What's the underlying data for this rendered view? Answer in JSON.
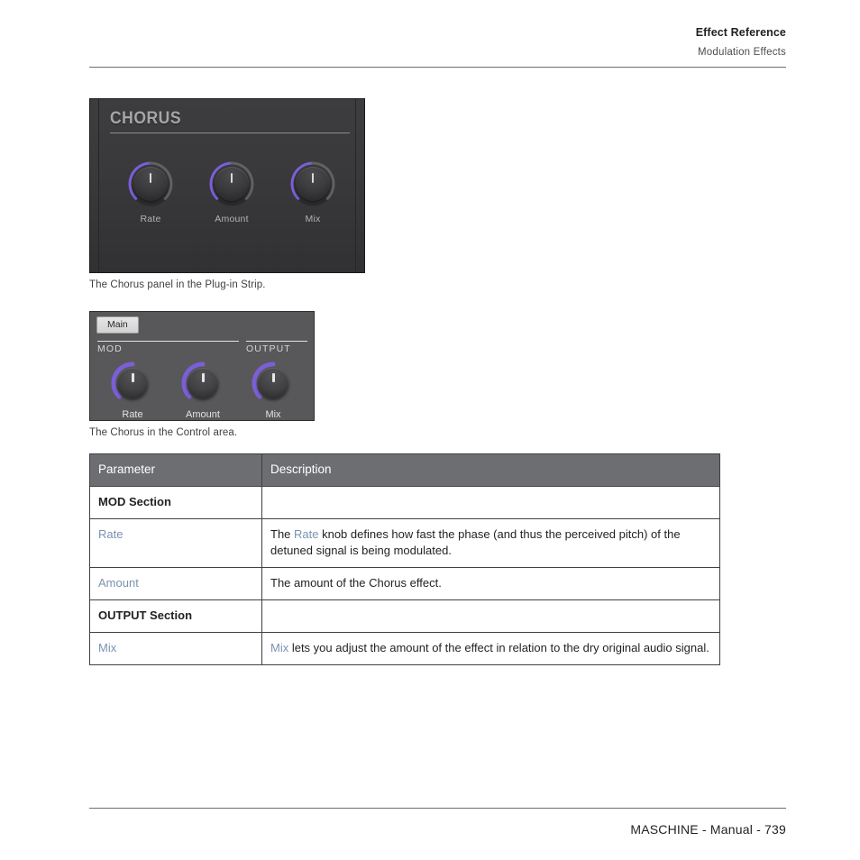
{
  "header": {
    "title": "Effect Reference",
    "subtitle": "Modulation Effects"
  },
  "plugin_strip": {
    "panel_title": "CHORUS",
    "knobs": [
      {
        "label": "Rate"
      },
      {
        "label": "Amount"
      },
      {
        "label": "Mix"
      }
    ],
    "caption": "The Chorus panel in the Plug-in Strip."
  },
  "control_area": {
    "tab": "Main",
    "sections": [
      {
        "name": "MOD"
      },
      {
        "name": "OUTPUT"
      }
    ],
    "knobs": [
      {
        "label": "Rate"
      },
      {
        "label": "Amount"
      },
      {
        "label": "Mix"
      }
    ],
    "caption": "The Chorus in the Control area."
  },
  "table": {
    "headers": {
      "parameter": "Parameter",
      "description": "Description"
    },
    "rows": [
      {
        "type": "section",
        "parameter": "MOD Section",
        "description": ""
      },
      {
        "type": "param",
        "parameter": "Rate",
        "desc_before": "The ",
        "desc_link": "Rate",
        "desc_after": " knob defines how fast the phase (and thus the perceived pitch) of the detuned signal is being modulated."
      },
      {
        "type": "param",
        "parameter": "Amount",
        "desc_before": "The amount of the Chorus effect.",
        "desc_link": "",
        "desc_after": ""
      },
      {
        "type": "section",
        "parameter": "OUTPUT Section",
        "description": ""
      },
      {
        "type": "param",
        "parameter": "Mix",
        "desc_before": "",
        "desc_link": "Mix",
        "desc_after": " lets you adjust the amount of the effect in relation to the dry original audio signal."
      }
    ]
  },
  "footer": {
    "text": "MASCHINE - Manual - 739"
  },
  "colors": {
    "accent_purple": "#7b5fd6",
    "link_blue": "#7a92b0",
    "table_header_gray": "#6d6e71",
    "panel_dark": "#38383a",
    "control_gray": "#58585a"
  }
}
